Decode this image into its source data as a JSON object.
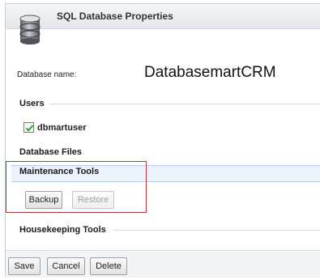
{
  "window": {
    "title": "SQL Database Properties",
    "icon": "database-icon"
  },
  "database": {
    "name_label": "Database name:",
    "name_value": "DatabasemartCRM"
  },
  "sections": {
    "users": "Users",
    "database_files": "Database Files",
    "maintenance_tools": "Maintenance Tools",
    "housekeeping_tools": "Housekeeping Tools"
  },
  "users": [
    {
      "name": "dbmartuser",
      "checked": true
    }
  ],
  "maintenance": {
    "backup_label": "Backup",
    "restore_label": "Restore",
    "restore_enabled": false
  },
  "footer": {
    "save_label": "Save",
    "cancel_label": "Cancel",
    "delete_label": "Delete"
  },
  "colors": {
    "highlight_border": "#b0333a",
    "band_background": "#eaf2fb",
    "check_green": "#2f8f2f"
  }
}
